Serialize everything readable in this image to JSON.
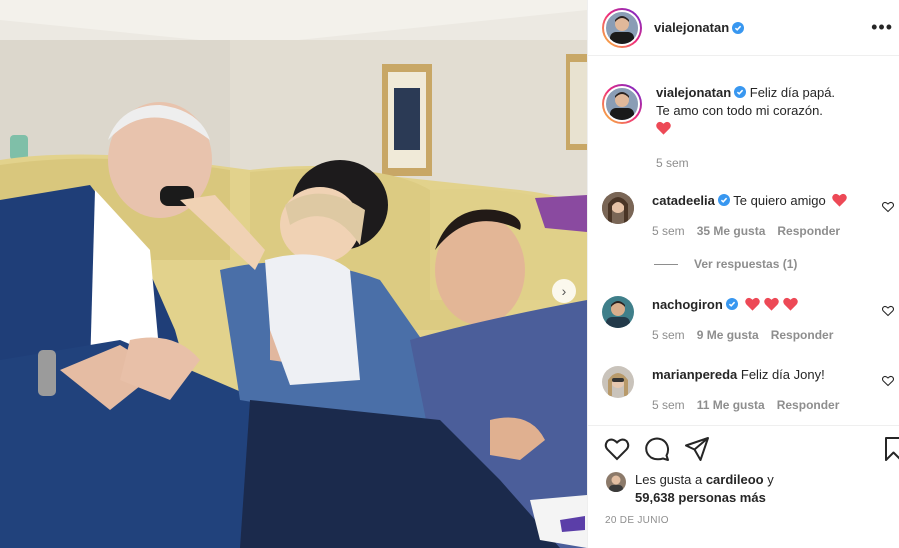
{
  "post": {
    "author": "vialejonatan",
    "verified_icon": "verified-badge-icon",
    "more_icon": "more-options-icon",
    "caption_line1": "Feliz día papá.",
    "caption_line2": "Te amo con todo mi corazón.",
    "caption_time": "5 sem",
    "date": "20 DE JUNIO"
  },
  "comments": [
    {
      "user": "catadeelia",
      "verified": true,
      "text": "Te quiero amigo",
      "hearts": 1,
      "time": "5 sem",
      "likes": "35 Me gusta",
      "reply": "Responder"
    },
    {
      "user": "nachogiron",
      "verified": true,
      "text": "",
      "hearts": 3,
      "time": "5 sem",
      "likes": "9 Me gusta",
      "reply": "Responder"
    },
    {
      "user": "marianpereda",
      "verified": false,
      "text": "Feliz día Jony!",
      "hearts": 0,
      "time": "5 sem",
      "likes": "11 Me gusta",
      "reply": "Responder"
    }
  ],
  "view_replies": "Ver respuestas (1)",
  "likes_summary": {
    "prefix": "Les gusta a ",
    "user": "cardileoo",
    "suffix": " y",
    "count": "59,638 personas más"
  },
  "colors": {
    "verified": "#3897f0",
    "heart": "#ed4956",
    "muted": "#8e8e8e"
  }
}
